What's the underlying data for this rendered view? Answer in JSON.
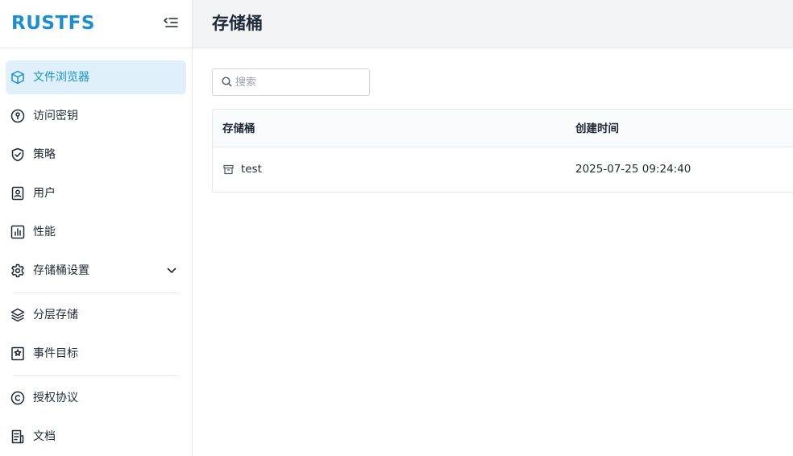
{
  "brand": {
    "logo_text": "RUSTFS",
    "accent_color": "#1a8fd1"
  },
  "header": {
    "title": "存储桶"
  },
  "sidebar": {
    "items": [
      {
        "label": "文件浏览器",
        "icon": "cube-icon",
        "active": true
      },
      {
        "label": "访问密钥",
        "icon": "key-circle-icon"
      },
      {
        "label": "策略",
        "icon": "shield-check-icon"
      },
      {
        "label": "用户",
        "icon": "user-badge-icon"
      },
      {
        "label": "性能",
        "icon": "bar-chart-icon"
      },
      {
        "label": "存储桶设置",
        "icon": "gear-icon",
        "expandable": true
      },
      {
        "label": "分层存储",
        "icon": "layers-icon"
      },
      {
        "label": "事件目标",
        "icon": "bookmark-star-icon"
      },
      {
        "label": "授权协议",
        "icon": "copyright-icon"
      },
      {
        "label": "文档",
        "icon": "document-icon"
      }
    ]
  },
  "search": {
    "placeholder": "搜索",
    "value": ""
  },
  "table": {
    "columns": [
      "存储桶",
      "创建时间"
    ],
    "rows": [
      {
        "name": "test",
        "created": "2025-07-25 09:24:40"
      }
    ]
  }
}
